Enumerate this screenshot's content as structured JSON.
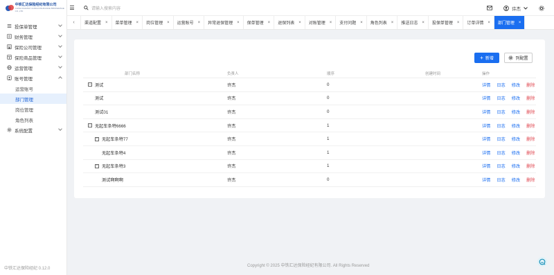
{
  "app": {
    "logo_title": "中铁汇达保险经纪有限公司",
    "logo_subtitle": "CHINA RAILWAY HUIDA INSURANCE BROKERAGE CO.,LTD",
    "version": "中铁汇达保险经纪 0.12.0",
    "footer": "Copyright © 2025 中铁汇达保险经纪有限公司. All Rights Reserved"
  },
  "header": {
    "search_placeholder": "请输入搜索内容",
    "user_name": "许杰"
  },
  "sidebar": {
    "items": [
      {
        "label": "投保单管理",
        "icon": "document-list-icon"
      },
      {
        "label": "财务管理",
        "icon": "wallet-icon"
      },
      {
        "label": "保险公司管理",
        "icon": "building-icon"
      },
      {
        "label": "保险商品管理",
        "icon": "product-icon"
      },
      {
        "label": "运营管理",
        "icon": "globe-icon"
      },
      {
        "label": "账号管理",
        "icon": "account-icon",
        "expanded": true,
        "children": [
          {
            "label": "运营账号"
          },
          {
            "label": "部门管理",
            "active": true
          },
          {
            "label": "岗位管理"
          },
          {
            "label": "角色列表"
          }
        ]
      },
      {
        "label": "系统配置",
        "icon": "gear-icon"
      }
    ]
  },
  "tabs": [
    {
      "label": "渠道配置"
    },
    {
      "label": "菜单管理"
    },
    {
      "label": "岗位管理"
    },
    {
      "label": "运营账号"
    },
    {
      "label": "异常退保管理"
    },
    {
      "label": "保单管理"
    },
    {
      "label": "退保列表"
    },
    {
      "label": "对账管理"
    },
    {
      "label": "支付问题"
    },
    {
      "label": "角色列表"
    },
    {
      "label": "推送日志"
    },
    {
      "label": "投保单管理"
    },
    {
      "label": "订单详情"
    },
    {
      "label": "部门管理",
      "active": true
    }
  ],
  "toolbar": {
    "add_label": "新增",
    "columns_label": "列配置"
  },
  "table": {
    "headers": {
      "name": "部门名称",
      "leader": "负责人",
      "order": "顺序",
      "created": "创建时间",
      "ops": "操作"
    },
    "ops": {
      "detail": "详情",
      "log": "日志",
      "edit": "修改",
      "delete": "删除"
    },
    "rows": [
      {
        "name": "测试",
        "leader": "许杰",
        "order": "0",
        "level": 0,
        "toggle": "−"
      },
      {
        "name": "测试",
        "leader": "许杰",
        "order": "0",
        "level": 1
      },
      {
        "name": "测试01",
        "leader": "许杰",
        "order": "0",
        "level": 1
      },
      {
        "name": "无起车条特6666",
        "leader": "许杰",
        "order": "1",
        "level": 0,
        "toggle": "−"
      },
      {
        "name": "无起车条特77",
        "leader": "许杰",
        "order": "1",
        "level": 1,
        "toggle": "−"
      },
      {
        "name": "无起车条特4",
        "leader": "许杰",
        "order": "1",
        "level": 2
      },
      {
        "name": "无起车条特3",
        "leader": "许杰",
        "order": "1",
        "level": 1,
        "toggle": "−"
      },
      {
        "name": "测试啊啊啊",
        "leader": "许杰",
        "order": "0",
        "level": 2
      }
    ]
  },
  "colors": {
    "primary": "#1a6ef0",
    "danger": "#e0454e"
  }
}
